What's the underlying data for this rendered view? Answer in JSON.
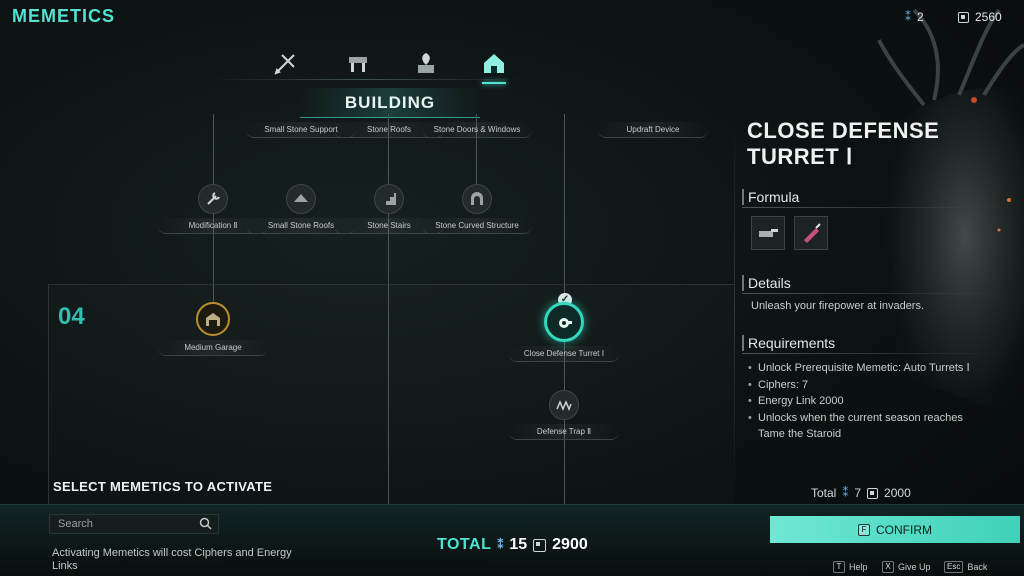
{
  "header": {
    "title": "MEMETICS",
    "ciphers": "2",
    "energy": "2560"
  },
  "tabs": [
    {
      "name": "tools",
      "icon": "crossbow-icon"
    },
    {
      "name": "crafting",
      "icon": "workbench-icon"
    },
    {
      "name": "farming",
      "icon": "planter-icon"
    },
    {
      "name": "building",
      "icon": "house-icon",
      "active": true
    }
  ],
  "section_title": "BUILDING",
  "tree": {
    "tier_label": "04",
    "nodes": {
      "small_stone_support": "Small Stone Support",
      "stone_roofs": "Stone Roofs",
      "stone_doors_windows": "Stone Doors & Windows",
      "updraft_device": "Updraft Device",
      "modification_2": "Modification Ⅱ",
      "small_stone_roofs": "Small Stone Roofs",
      "stone_stairs": "Stone Stairs",
      "stone_curved_structure": "Stone Curved Structure",
      "medium_garage": "Medium Garage",
      "close_defense_turret": "Close Defense Turret Ⅰ",
      "defense_trap_2": "Defense Trap Ⅱ"
    }
  },
  "detail": {
    "title": "CLOSE DEFENSE TURRET Ⅰ",
    "formula_heading": "Formula",
    "details_heading": "Details",
    "details_text": "Unleash your firepower at invaders.",
    "requirements_heading": "Requirements",
    "requirements": [
      "Unlock Prerequisite Memetic: Auto Turrets Ⅰ",
      "Ciphers:  7",
      "Energy Link 2000",
      "Unlocks when the current season reaches Tame the Staroid"
    ],
    "total_label": "Total",
    "total_ciphers": "7",
    "total_energy": "2000"
  },
  "bottom": {
    "select_title": "SELECT MEMETICS TO ACTIVATE",
    "search_placeholder": "Search",
    "footnote": "Activating Memetics will cost Ciphers and Energy Links",
    "total_label": "TOTAL",
    "total_ciphers": "15",
    "total_energy": "2900",
    "confirm_key": "F",
    "confirm_label": "CONFIRM",
    "hints": [
      {
        "key": "T",
        "label": "Help"
      },
      {
        "key": "X",
        "label": "Give Up"
      },
      {
        "key": "Esc",
        "label": "Back"
      }
    ]
  },
  "colors": {
    "accent": "#4fe3d2",
    "selected_node": "#2fd8be",
    "gold_node": "#b98f2e",
    "confirm": "#5fe0cb"
  }
}
